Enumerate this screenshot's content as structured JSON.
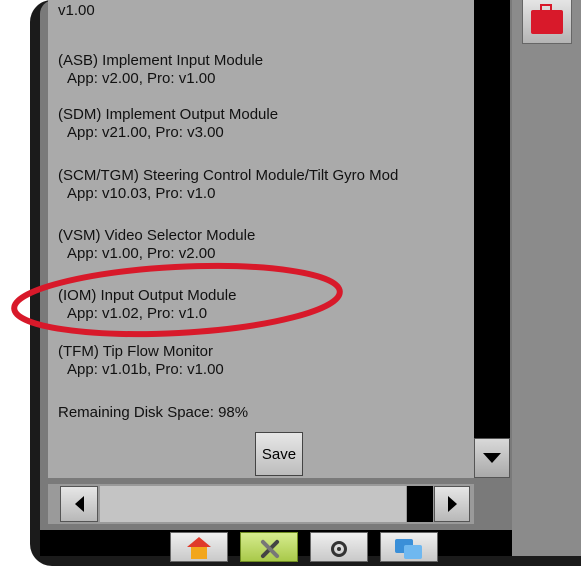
{
  "modules": [
    {
      "name": "",
      "versions": "v1.00"
    },
    {
      "name": "(ASB) Implement Input Module",
      "versions": "App: v2.00, Pro: v1.00"
    },
    {
      "name": "(SDM) Implement Output Module",
      "versions": "App: v21.00, Pro: v3.00"
    },
    {
      "name": "(SCM/TGM) Steering Control Module/Tilt Gyro Mod",
      "versions": "App: v10.03, Pro: v1.0"
    },
    {
      "name": "(VSM) Video Selector Module",
      "versions": "App: v1.00, Pro: v2.00"
    },
    {
      "name": "(IOM) Input Output Module",
      "versions": "App: v1.02, Pro: v1.0"
    },
    {
      "name": "(TFM) Tip Flow Monitor",
      "versions": "App: v1.01b, Pro: v1.00"
    }
  ],
  "disk_space": "Remaining Disk Space: 98%",
  "save_label": "Save",
  "icons": {
    "toolbox": "toolbox-icon",
    "home": "home-icon",
    "tools": "tools-icon",
    "gps": "gps-icon",
    "windows": "windows-icon"
  },
  "colors": {
    "content_bg": "#aaaaaa",
    "active_tab": "#a9c94a",
    "highlight_ellipse": "#d8192a",
    "toolbox": "#d8192a"
  }
}
